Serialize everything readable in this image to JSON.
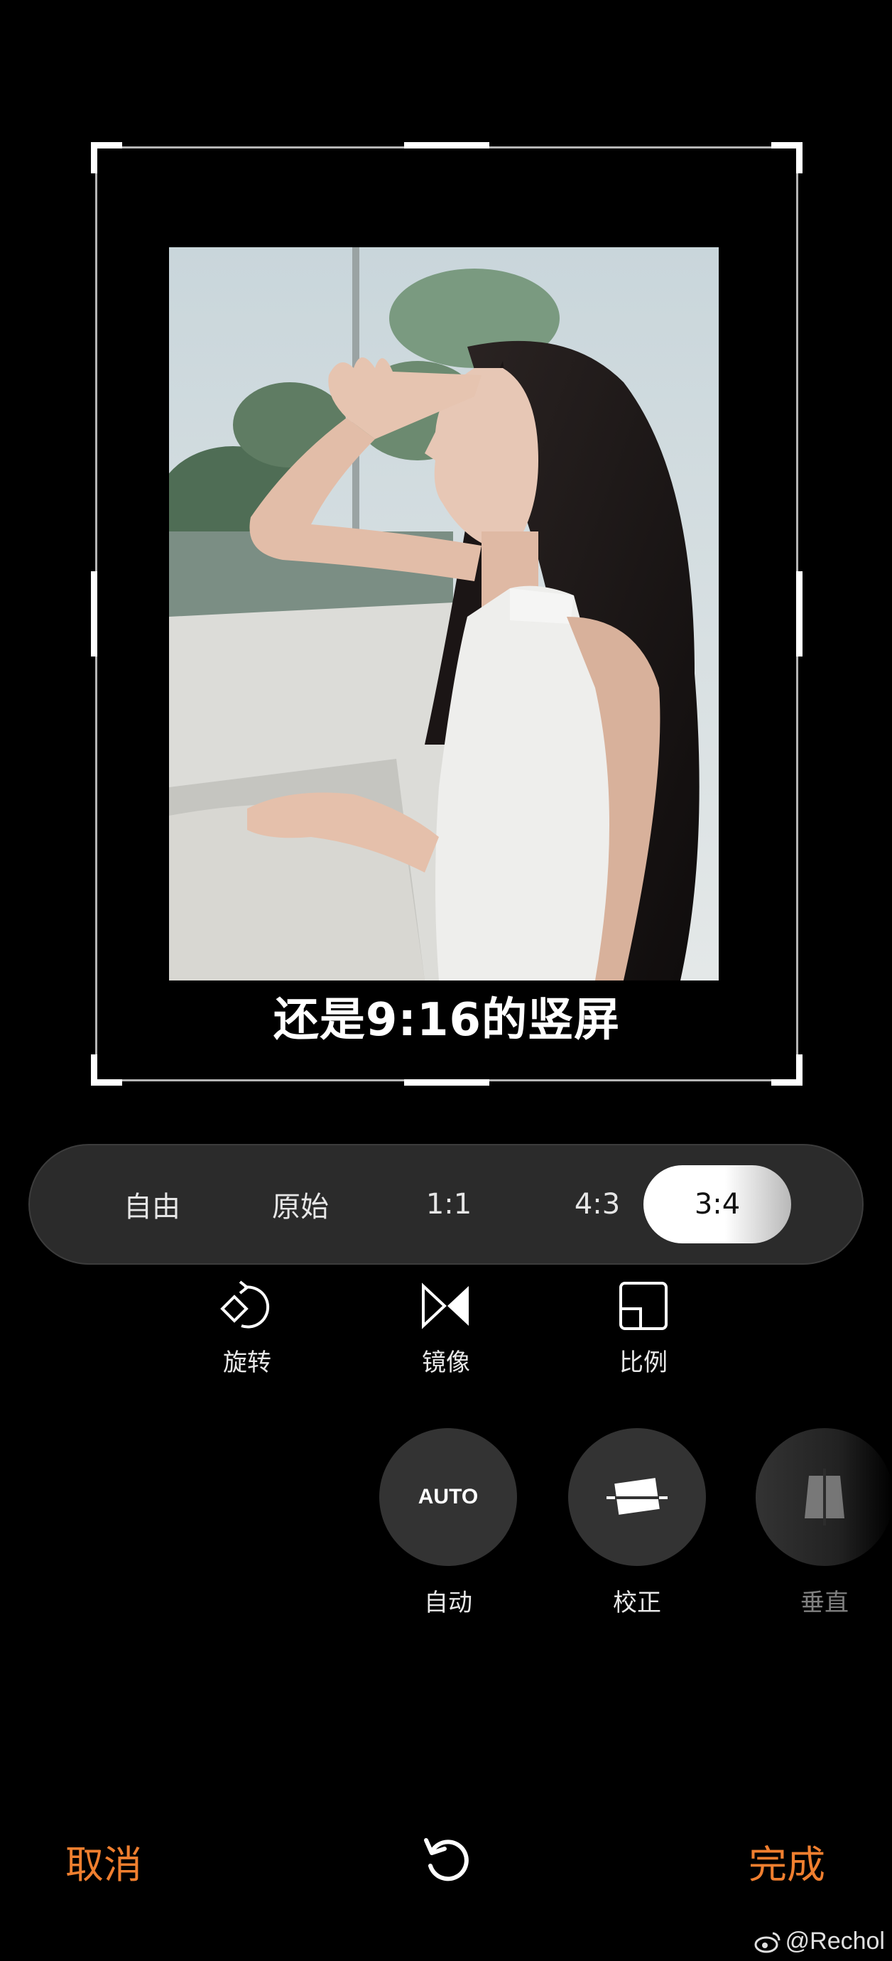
{
  "photo_caption": "还是9:16的竖屏",
  "ratio_options": [
    "自由",
    "原始",
    "1:1",
    "4:3",
    "3:4"
  ],
  "selected_ratio": "3:4",
  "tools": {
    "rotate": "旋转",
    "mirror": "镜像",
    "ratio": "比例"
  },
  "adjust": {
    "auto_label": "自动",
    "auto_icon_text": "AUTO",
    "correct_label": "校正",
    "vertical_label": "垂直"
  },
  "bottom": {
    "cancel": "取消",
    "done": "完成"
  },
  "watermark": "@Rechol",
  "colors": {
    "accent": "#F07F2F",
    "background": "#000000",
    "panel": "#2B2B2B",
    "active_chip": "#FFFFFF"
  }
}
